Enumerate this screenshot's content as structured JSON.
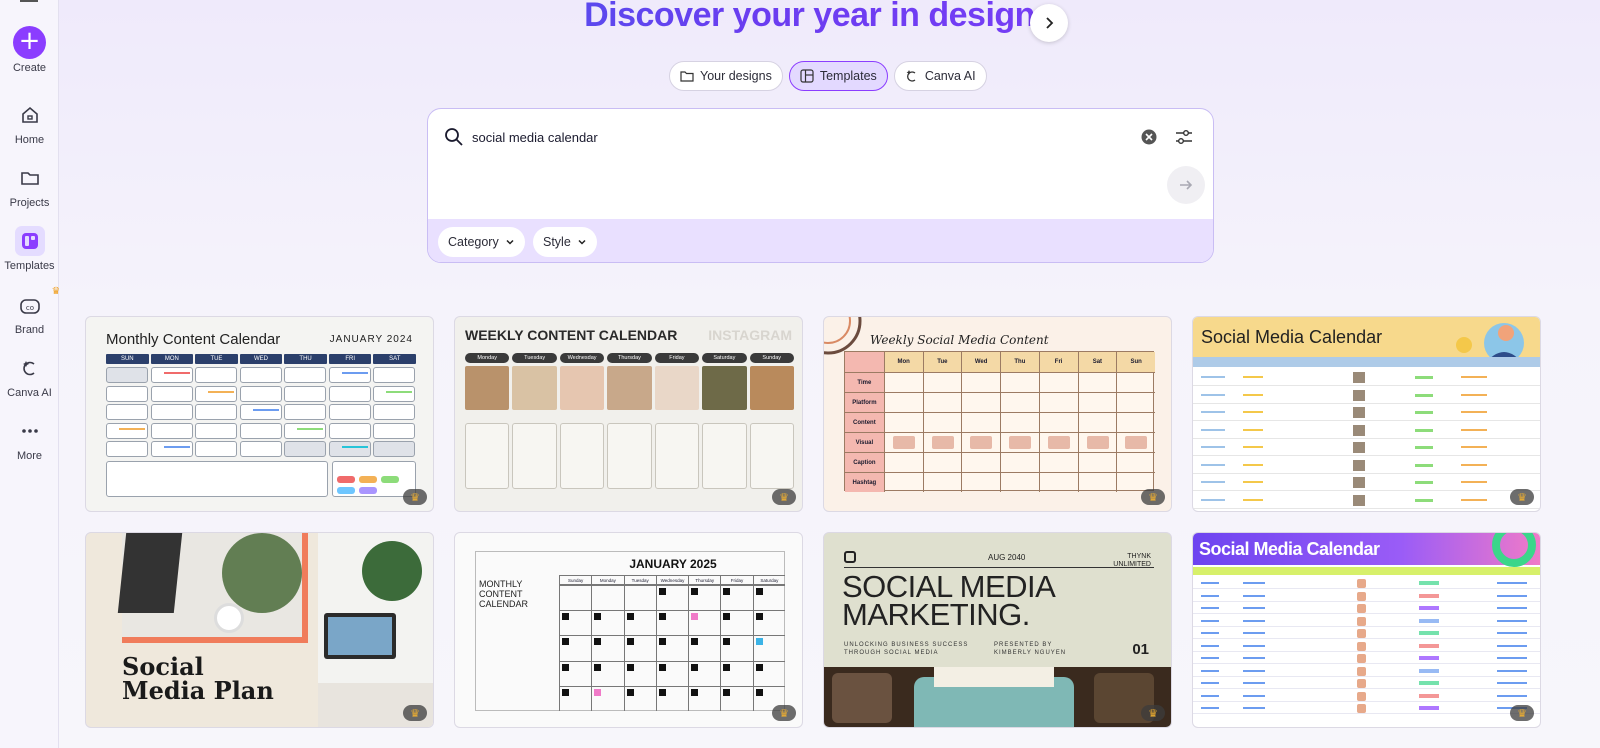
{
  "sidebar": {
    "create_label": "Create",
    "items": [
      {
        "label": "Home",
        "icon": "home-icon"
      },
      {
        "label": "Projects",
        "icon": "folder-icon"
      },
      {
        "label": "Templates",
        "icon": "templates-icon"
      },
      {
        "label": "Brand",
        "icon": "brand-icon"
      },
      {
        "label": "Canva AI",
        "icon": "canva-ai-icon"
      },
      {
        "label": "More",
        "icon": "more-icon"
      }
    ]
  },
  "hero": {
    "title": "Discover your year in design"
  },
  "tabs": [
    {
      "label": "Your designs",
      "icon": "folder-icon"
    },
    {
      "label": "Templates",
      "icon": "templates-icon",
      "active": true
    },
    {
      "label": "Canva AI",
      "icon": "canva-ai-icon"
    }
  ],
  "search": {
    "value": "social media calendar"
  },
  "filters": [
    {
      "label": "Category"
    },
    {
      "label": "Style"
    }
  ],
  "results": [
    {
      "title": "Monthly Content Calendar",
      "subtitle": "JANUARY 2024",
      "days": [
        "SUN",
        "MON",
        "TUE",
        "WED",
        "THU",
        "FRI",
        "SAT"
      ],
      "premium": true
    },
    {
      "title": "WEEKLY CONTENT CALENDAR",
      "subtitle": "INSTAGRAM",
      "days": [
        "Monday",
        "Tuesday",
        "Wednesday",
        "Thursday",
        "Friday",
        "Saturday",
        "Sunday"
      ],
      "premium": true
    },
    {
      "title": "Weekly Social Media Content",
      "days": [
        "Mon",
        "Tue",
        "Wed",
        "Thu",
        "Fri",
        "Sat",
        "Sun"
      ],
      "rows": [
        "Time",
        "Platform",
        "Content",
        "Visual",
        "Caption",
        "Hashtag"
      ],
      "premium": true
    },
    {
      "title": "Social Media Calendar",
      "premium": true
    },
    {
      "title": "Social Media Plan",
      "premium": true
    },
    {
      "title": "JANUARY 2025",
      "subtitle": "MONTHLY CONTENT CALENDAR",
      "days": [
        "Sunday",
        "Monday",
        "Tuesday",
        "Wednesday",
        "Thursday",
        "Friday",
        "Saturday"
      ],
      "premium": true
    },
    {
      "title": "SOCIAL MEDIA MARKETING.",
      "date": "AUG 2040",
      "brand": "THYNK UNLIMITED",
      "tagline": "UNLOCKING BUSINESS SUCCESS THROUGH SOCIAL MEDIA",
      "presenter": "PRESENTED BY KIMBERLY NGUYEN",
      "number": "01",
      "premium": true
    },
    {
      "title": "Social Media Calendar",
      "premium": true
    }
  ],
  "colors": {
    "accent": "#8b3dff",
    "accent_light": "#e4dcff",
    "navy": "#2b3f6b",
    "premium_badge": "#f0a020"
  }
}
